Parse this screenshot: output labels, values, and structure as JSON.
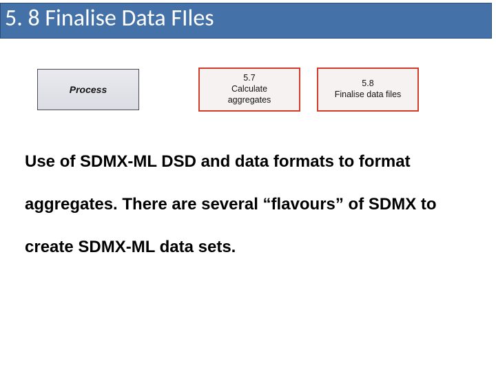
{
  "title": "5. 8 Finalise Data FIles",
  "diagram": {
    "process_label": "Process",
    "box57": {
      "num": "5.7",
      "l1": "Calculate",
      "l2": "aggregates"
    },
    "box58": {
      "num": "5.8",
      "l1": "Finalise data files"
    }
  },
  "body": "Use of SDMX-ML DSD and data formats to format aggregates. There are several “flavours” of SDMX to create SDMX-ML data sets."
}
